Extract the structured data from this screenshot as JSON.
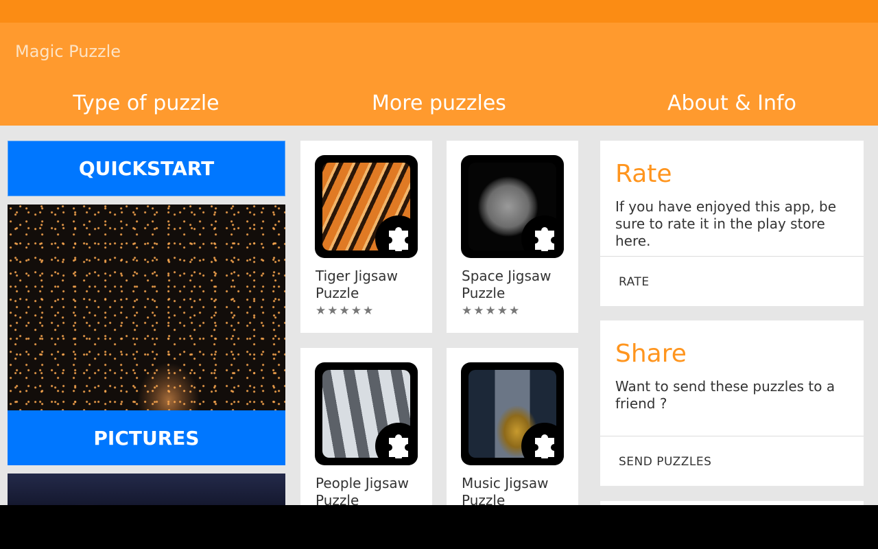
{
  "app": {
    "title": "Magic Puzzle"
  },
  "tabs": [
    {
      "label": "Type of puzzle"
    },
    {
      "label": "More puzzles"
    },
    {
      "label": "About & Info"
    }
  ],
  "left": {
    "quickstart_label": "QUICKSTART",
    "pictures_label": "PICTURES"
  },
  "puzzles": [
    {
      "title": "Tiger Jigsaw Puzzle",
      "rating": "★★★★★"
    },
    {
      "title": "Space Jigsaw Puzzle",
      "rating": "★★★★★"
    },
    {
      "title": "People Jigsaw Puzzle"
    },
    {
      "title": "Music Jigsaw Puzzle"
    }
  ],
  "info": {
    "rate": {
      "heading": "Rate",
      "text": "If you have enjoyed this app, be sure to rate it in the play store here.",
      "action": "RATE"
    },
    "share": {
      "heading": "Share",
      "text": "Want to send these puzzles to a friend ?",
      "action": "SEND PUZZLES"
    }
  },
  "colors": {
    "statusbar": "#fb8c14",
    "appbar": "#ff9a2e",
    "button_blue": "#0077ff",
    "accent_orange": "#ff951e",
    "background": "#e6e6e6"
  },
  "icons": {
    "puzzle_badge": "puzzle-piece-icon"
  }
}
